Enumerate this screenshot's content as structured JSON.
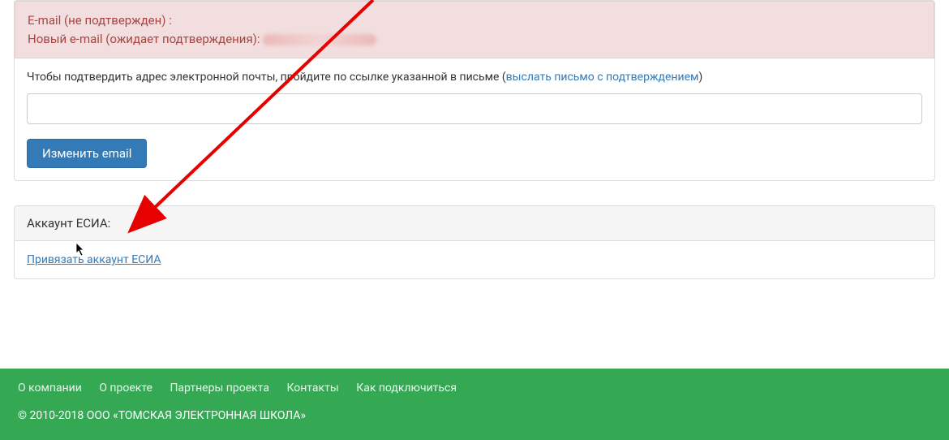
{
  "alert": {
    "line1": "E-mail (не подтвержден) :",
    "line2_label": "Новый e-mail (ожидает подтверждения): "
  },
  "confirm": {
    "text_before": "Чтобы подтвердить адрес электронной почты, пройдите по ссылке указанной в письме (",
    "link": "выслать письмо с подтверждением",
    "text_after": ")"
  },
  "email_input": {
    "value": ""
  },
  "buttons": {
    "change_email": "Изменить email"
  },
  "esia": {
    "heading": "Аккаунт ЕСИА:",
    "link": "Привязать аккаунт ЕСИА"
  },
  "footer": {
    "links": [
      "О компании",
      "О проекте",
      "Партнеры проекта",
      "Контакты",
      "Как подключиться"
    ],
    "copyright": "© 2010-2018 ООО «ТОМСКАЯ ЭЛЕКТРОННАЯ ШКОЛА»"
  }
}
